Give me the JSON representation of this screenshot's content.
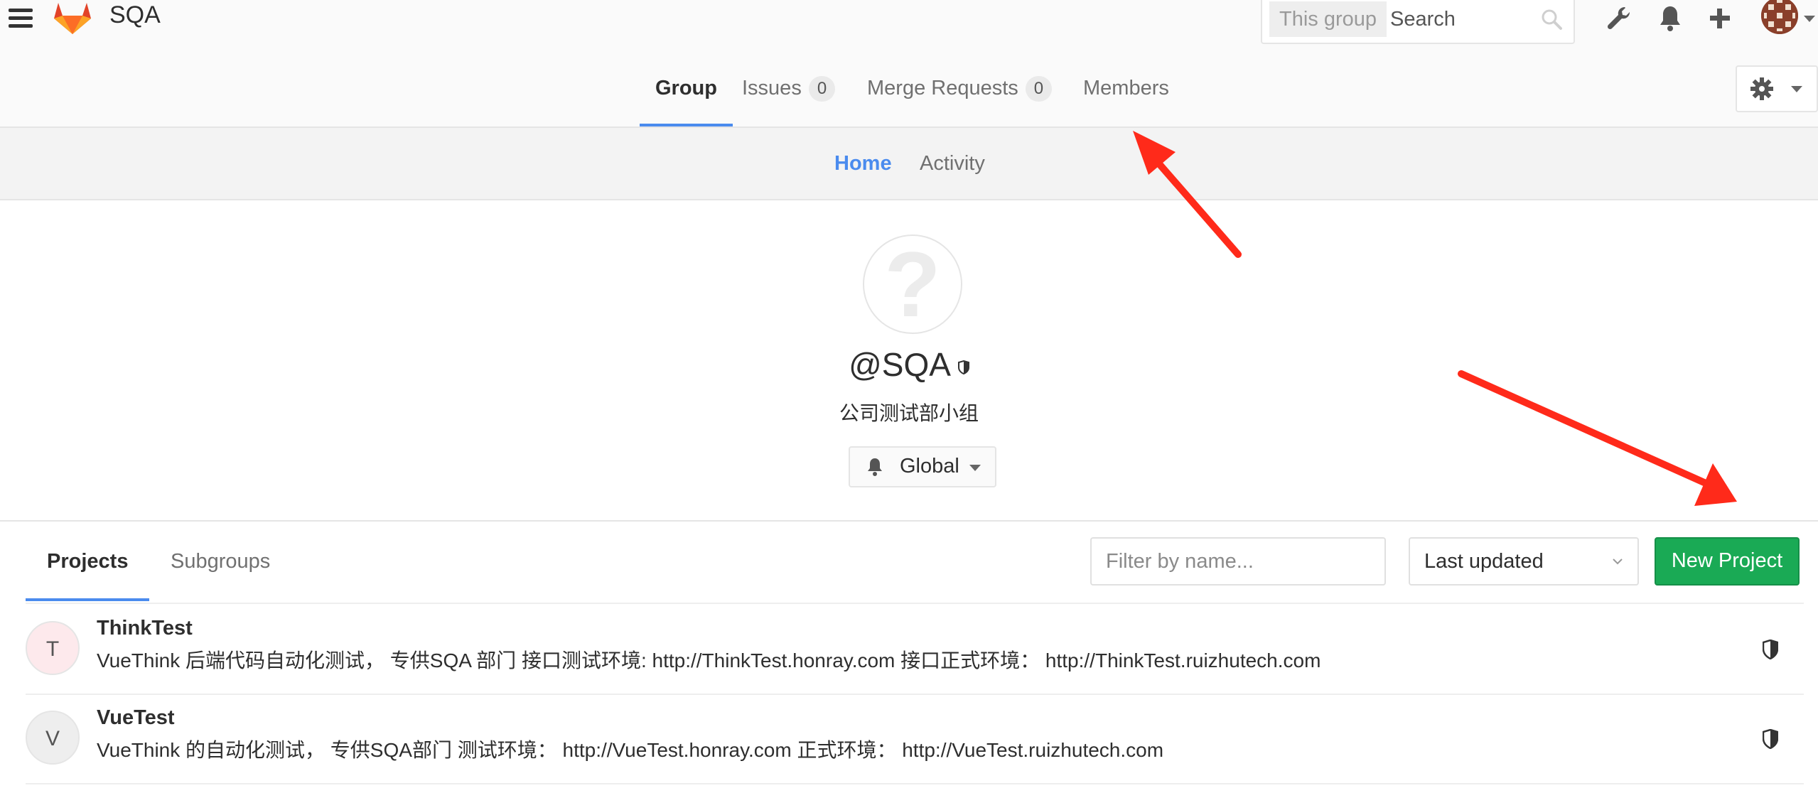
{
  "header": {
    "brand": "SQA",
    "search": {
      "scope": "This group",
      "placeholder": "Search"
    },
    "icons": [
      "wrench-icon",
      "bell-icon",
      "plus-icon",
      "avatar"
    ]
  },
  "group_nav": {
    "tabs": [
      {
        "label": "Group",
        "active": true
      },
      {
        "label": "Issues",
        "count": "0"
      },
      {
        "label": "Merge Requests",
        "count": "0"
      },
      {
        "label": "Members"
      }
    ]
  },
  "sub_nav": {
    "tabs": [
      {
        "label": "Home",
        "active": true
      },
      {
        "label": "Activity"
      }
    ]
  },
  "group": {
    "avatar_glyph": "?",
    "name": "@SQA",
    "description": "公司测试部小组",
    "notification_level": "Global"
  },
  "projects_section": {
    "tabs": [
      {
        "label": "Projects",
        "active": true
      },
      {
        "label": "Subgroups"
      }
    ],
    "filter_placeholder": "Filter by name...",
    "sort_selected": "Last updated",
    "new_project_label": "New Project"
  },
  "projects": [
    {
      "initial": "T",
      "name": "ThinkTest",
      "description": "VueThink 后端代码自动化测试， 专供SQA 部门 接口测试环境: http://ThinkTest.honray.com 接口正式环境： http://ThinkTest.ruizhutech.com",
      "avatar_color": "#fde9ec"
    },
    {
      "initial": "V",
      "name": "VueTest",
      "description": "VueThink 的自动化测试， 专供SQA部门 测试环境： http://VueTest.honray.com 正式环境： http://VueTest.ruizhutech.com",
      "avatar_color": "#eeeeee"
    }
  ],
  "colors": {
    "accent": "#4a8bee",
    "success": "#1aaa55",
    "annotation_arrow": "#ff2a1a"
  }
}
